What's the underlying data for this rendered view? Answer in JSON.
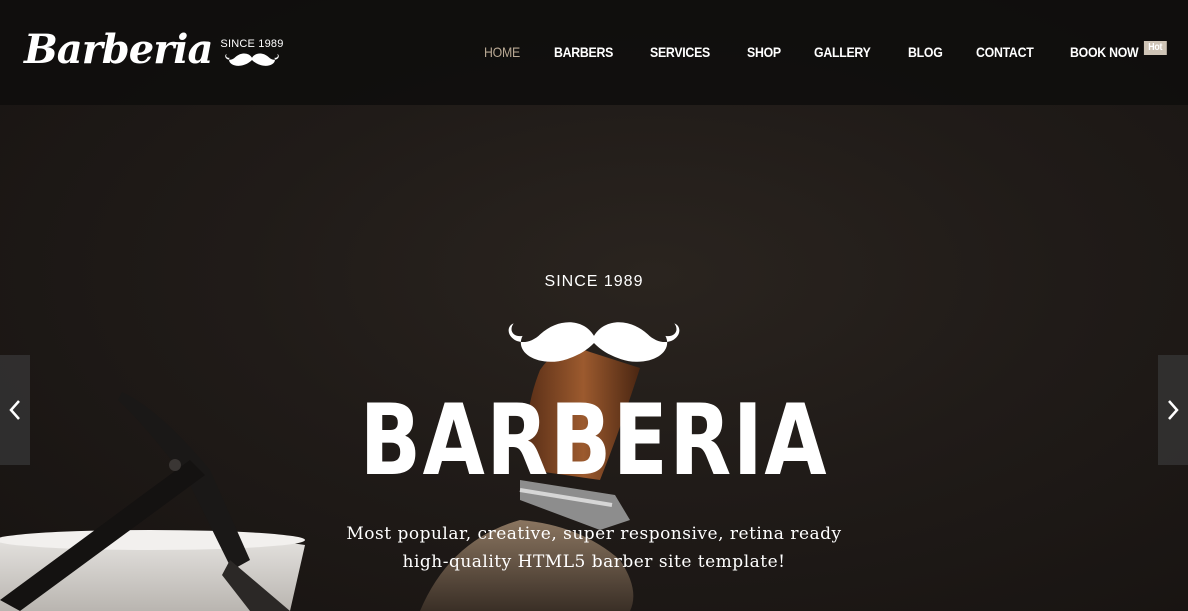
{
  "brand": {
    "name": "Barberia",
    "since": "SINCE 1989"
  },
  "nav": {
    "items": [
      {
        "label": "HOME",
        "active": true
      },
      {
        "label": "BARBERS",
        "active": false
      },
      {
        "label": "SERVICES",
        "active": false
      },
      {
        "label": "SHOP",
        "active": false
      },
      {
        "label": "GALLERY",
        "active": false
      },
      {
        "label": "BLOG",
        "active": false
      },
      {
        "label": "CONTACT",
        "active": false
      },
      {
        "label": "BOOK NOW",
        "active": false
      }
    ],
    "badge": "Hot"
  },
  "hero": {
    "since": "SINCE 1989",
    "title": "BARBERIA",
    "subtitle_line1": "Most popular, creative, super responsive, retina ready",
    "subtitle_line2": "high-quality HTML5 barber site template!"
  },
  "icons": {
    "mustache": "mustache-icon",
    "prev": "chevron-left-icon",
    "next": "chevron-right-icon"
  },
  "colors": {
    "header_bg": "#0f0e0d",
    "hero_bg": "#201b18",
    "nav_active": "#b8a893",
    "badge_bg": "#cfc4b6",
    "text": "#ffffff"
  }
}
